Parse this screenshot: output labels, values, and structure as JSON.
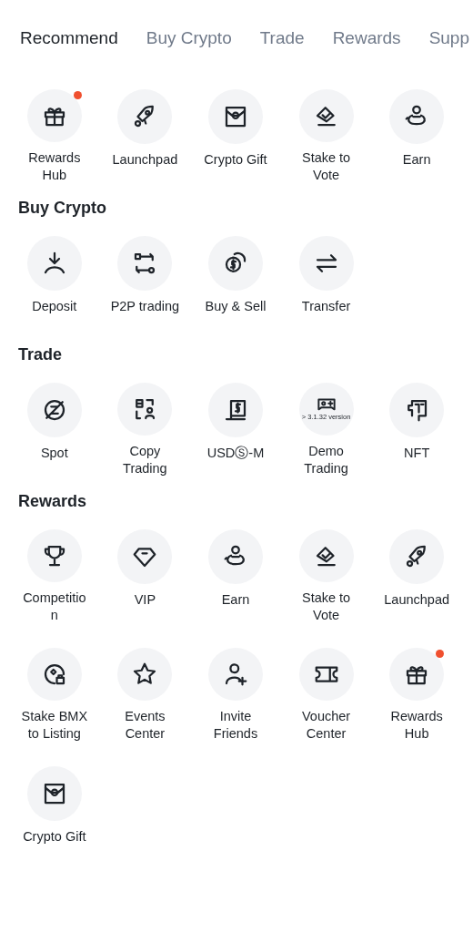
{
  "tabs": [
    {
      "label": "Recommend",
      "selected": true
    },
    {
      "label": "Buy Crypto",
      "selected": false
    },
    {
      "label": "Trade",
      "selected": false
    },
    {
      "label": "Rewards",
      "selected": false
    },
    {
      "label": "Supp",
      "selected": false
    }
  ],
  "sections": [
    {
      "items": [
        {
          "label": "Rewards Hub",
          "notified": true
        },
        {
          "label": "Launchpad",
          "notified": false
        },
        {
          "label": "Crypto Gift",
          "notified": false
        },
        {
          "label": "Stake to Vote",
          "notified": false
        },
        {
          "label": "Earn",
          "notified": false
        }
      ]
    },
    {
      "title": "Buy Crypto",
      "items": [
        {
          "label": "Deposit",
          "notified": false
        },
        {
          "label": "P2P trading",
          "notified": false
        },
        {
          "label": "Buy & Sell",
          "notified": false
        },
        {
          "label": "Transfer",
          "notified": false
        }
      ]
    },
    {
      "title": "Trade",
      "items": [
        {
          "label": "Spot",
          "notified": false
        },
        {
          "label": "Copy Trading",
          "notified": false
        },
        {
          "label": "USDⓈ-M",
          "notified": false
        },
        {
          "label": "Demo Trading",
          "notified": false,
          "icon_caption": "> 3.1.32 version"
        },
        {
          "label": "NFT",
          "notified": false
        }
      ]
    },
    {
      "title": "Rewards",
      "items": [
        {
          "label": "Competition",
          "notified": false
        },
        {
          "label": "VIP",
          "notified": false
        },
        {
          "label": "Earn",
          "notified": false
        },
        {
          "label": "Stake to Vote",
          "notified": false
        },
        {
          "label": "Launchpad",
          "notified": false
        },
        {
          "label": "Stake BMX to Listing",
          "notified": false
        },
        {
          "label": "Events Center",
          "notified": false
        },
        {
          "label": "Invite Friends",
          "notified": false
        },
        {
          "label": "Voucher Center",
          "notified": false
        },
        {
          "label": "Rewards Hub",
          "notified": true
        },
        {
          "label": "Crypto Gift",
          "notified": false
        }
      ]
    }
  ]
}
